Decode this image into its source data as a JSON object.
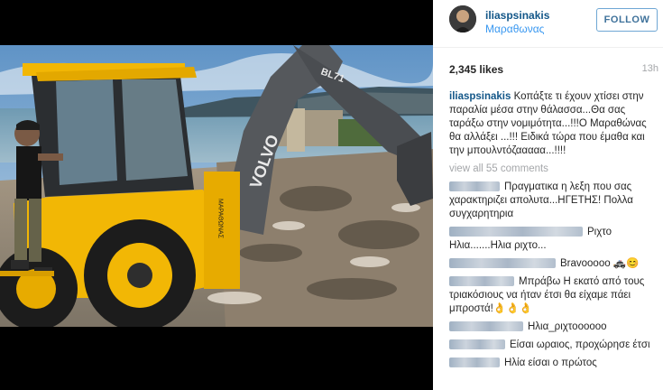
{
  "post": {
    "username": "iliaspsinakis",
    "location": "Μαραθωνας",
    "follow_label": "FOLLOW",
    "likes": "2,345 likes",
    "time": "13h",
    "caption_user": "iliaspsinakis",
    "caption_text": "Κοπάξτε τι έχουν χτίσει στην παραλία μέσα στην θάλασσα...Θα σας ταράξω στην νομιμότητα...!!!Ο Μαραθώνας θα αλλάξει ...!!! Ειδικά τώρα που έμαθα και την μπουλντόζααααα...!!!!",
    "view_all": "view all 55 comments",
    "excavator_brand": "VOLVO",
    "arm_marking": "BL71",
    "side_marking": "ΜΑΡΑΘΩΝΑΣ"
  },
  "comments": [
    {
      "text": "Πραγματικα η λεξη που σας χαρακτηριζει απολυτα...ΗΓΕΤΗΣ! Πολλα συγχαρητηρια"
    },
    {
      "text": "Ριχτο Ηλια.......Ηλια ριχτο..."
    },
    {
      "text": "Bravooooo 🚓😊"
    },
    {
      "text": "Μπράβω Η εκατό από τους τριακόσιους να ήταν έτσι θα είχαμε πάει μπροστά!👌👌👌"
    },
    {
      "text": "Ηλια_ριχτοοοοοο"
    },
    {
      "text": "Είσαι ωραιος, προχώρησε έτσι"
    },
    {
      "text": "Ηλία είσαι ο πρώτος"
    }
  ],
  "colors": {
    "username": "#125688",
    "location": "#3897f0",
    "follow_border": "#6fa7d4",
    "muted": "#a5a7aa",
    "excavator_yellow": "#f2b705"
  }
}
